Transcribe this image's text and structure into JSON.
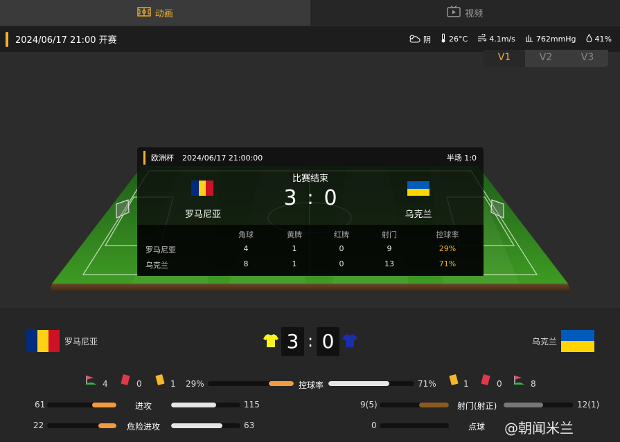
{
  "tabs": [
    {
      "label": "动画",
      "icon": "pitch-icon",
      "active": true
    },
    {
      "label": "视频",
      "icon": "tv-icon",
      "active": false
    }
  ],
  "info": {
    "kickoff": "2024/06/17 21:00 开赛",
    "weather": "阴",
    "temperature": "26°C",
    "wind": "4.1m/s",
    "pressure": "762mmHg",
    "humidity": "41%"
  },
  "view_switch": [
    "V1",
    "V2",
    "V3"
  ],
  "card": {
    "competition": "欧洲杯",
    "datetime": "2024/06/17 21:00:00",
    "half": "半场 1:0",
    "status": "比赛结束",
    "home_team": "罗马尼亚",
    "away_team": "乌克兰",
    "home_score": "3",
    "away_score": "0",
    "separator": ":",
    "headers": [
      "角球",
      "黄牌",
      "红牌",
      "射门",
      "控球率"
    ],
    "rows": [
      {
        "team": "罗马尼亚",
        "values": [
          "4",
          "1",
          "0",
          "9",
          "29%"
        ]
      },
      {
        "team": "乌克兰",
        "values": [
          "8",
          "1",
          "0",
          "13",
          "71%"
        ]
      }
    ]
  },
  "bottom": {
    "home_team": "罗马尼亚",
    "away_team": "乌克兰",
    "home_score": "3",
    "away_score": "0",
    "separator": ":",
    "home_corners": "4",
    "home_red": "0",
    "home_yellow": "1",
    "away_yellow": "1",
    "away_red": "0",
    "away_corners": "8",
    "possession": {
      "label": "控球率",
      "home": "29%",
      "away": "71%",
      "home_frac": 0.29,
      "away_frac": 0.71
    },
    "attack": {
      "label": "进攻",
      "home": "61",
      "away": "115",
      "home_frac": 0.35,
      "away_frac": 0.65
    },
    "dangerous": {
      "label": "危险进攻",
      "home": "22",
      "away": "63",
      "home_frac": 0.26,
      "away_frac": 0.74
    },
    "shots": {
      "label": "射门(射正)",
      "home": "9(5)",
      "away": "12(1)",
      "home_frac": 0.43,
      "away_frac": 0.57
    },
    "penalty": {
      "label": "点球",
      "home": "0",
      "away": "",
      "home_frac": 0.0,
      "away_frac": 0.0
    }
  },
  "watermark": "@朝闻米兰",
  "colors": {
    "accent": "#f2b02c",
    "orange_bar": "#f59a3c",
    "white_bar": "#e6e6e6",
    "grey_bar": "#777777"
  }
}
